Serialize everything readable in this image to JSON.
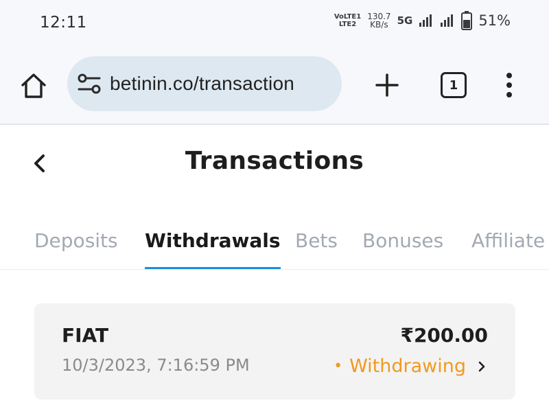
{
  "status_bar": {
    "time": "12:11",
    "volte_top": "VoLTE1",
    "volte_bottom": "LTE2",
    "speed_value": "130.7",
    "speed_unit": "KB/s",
    "network": "5G",
    "battery": "51%"
  },
  "browser": {
    "url": "betinin.co/transaction",
    "tab_count": "1"
  },
  "page": {
    "title": "Transactions"
  },
  "tabs": [
    {
      "label": "Deposits",
      "active": false
    },
    {
      "label": "Withdrawals",
      "active": true
    },
    {
      "label": "Bets",
      "active": false
    },
    {
      "label": "Bonuses",
      "active": false
    },
    {
      "label": "Affiliate",
      "active": false
    }
  ],
  "transactions": [
    {
      "type": "FIAT",
      "date": "10/3/2023, 7:16:59 PM",
      "amount": "₹200.00",
      "status": "Withdrawing",
      "status_color": "#f09a1e"
    }
  ],
  "colors": {
    "accent": "#1b8fe0",
    "status_pending": "#f09a1e",
    "address_bar": "#dde8f1"
  }
}
